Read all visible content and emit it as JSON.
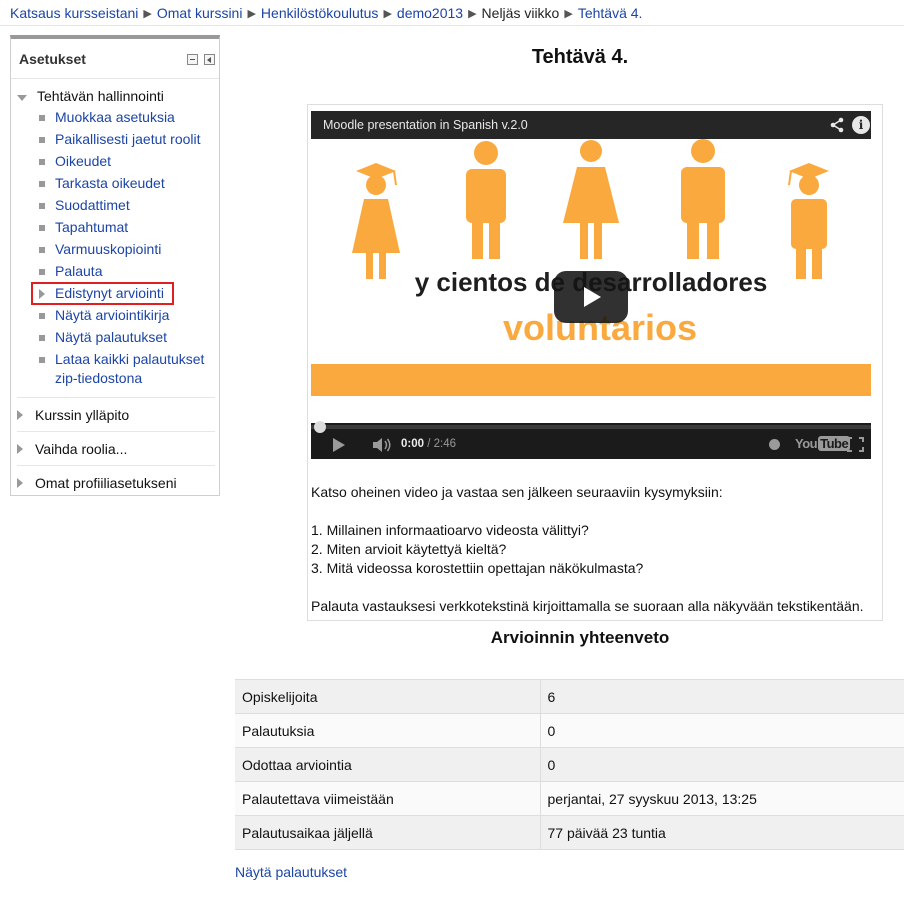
{
  "breadcrumb": {
    "items": [
      "Katsaus kursseistani",
      "Omat kurssini",
      "Henkilöstökoulutus",
      "demo2013",
      "Neljäs viikko",
      "Tehtävä 4."
    ]
  },
  "settings_block": {
    "title": "Asetukset",
    "root_label": "Tehtävän hallinnointi",
    "items": [
      "Muokkaa asetuksia",
      "Paikallisesti jaetut roolit",
      "Oikeudet",
      "Tarkasta oikeudet",
      "Suodattimet",
      "Tapahtumat",
      "Varmuuskopiointi",
      "Palauta",
      "Edistynyt arviointi",
      "Näytä arviointikirja",
      "Näytä palautukset",
      "Lataa kaikki palautukset zip-tiedostona"
    ],
    "other_sections": [
      "Kurssin ylläpito",
      "Vaihda roolia...",
      "Omat profiiliasetukseni"
    ]
  },
  "page": {
    "title": "Tehtävä 4."
  },
  "video": {
    "title": "Moodle presentation in Spanish v.2.0",
    "line1": "y cientos de desarrolladores",
    "line2": "voluntarios",
    "time_current": "0:00",
    "time_total": " / 2:46",
    "youtube_label": "You",
    "youtube_tube": "Tube",
    "progress": 0,
    "accent_color": "#f9a93d"
  },
  "intro": {
    "lead": "Katso oheinen video ja vastaa sen jälkeen seuraaviin kysymyksiin:",
    "questions": [
      "1. Millainen informaatioarvo videosta välittyi?",
      "2. Miten arvioit käytettyä kieltä?",
      "3. Mitä videossa korostettiin opettajan näkökulmasta?"
    ],
    "closing": "Palauta vastauksesi verkkotekstinä kirjoittamalla se suoraan alla näkyvään tekstikentään."
  },
  "summary": {
    "title": "Arvioinnin yhteenveto",
    "rows": [
      [
        "Opiskelijoita",
        "6"
      ],
      [
        "Palautuksia",
        "0"
      ],
      [
        "Odottaa arviointia",
        "0"
      ],
      [
        "Palautettava viimeistään",
        "perjantai, 27 syyskuu 2013, 13:25"
      ],
      [
        "Palautusaikaa jäljellä",
        "77 päivää 23 tuntia"
      ]
    ]
  },
  "bottom_link": "Näytä palautukset",
  "colors": {
    "link": "#1c45a6",
    "highlight_border": "#e02020"
  }
}
